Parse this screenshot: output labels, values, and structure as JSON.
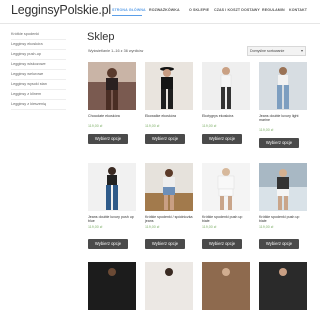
{
  "site": {
    "logo": "LegginsyPolskie.pl"
  },
  "nav": {
    "items": [
      {
        "label": "STRONA GŁÓWNA",
        "active": true
      },
      {
        "label": "ROZWAŻKÓWKA",
        "active": false
      },
      {
        "label": "O SKLEPIE",
        "active": false
      },
      {
        "label": "CZAS I KOSZT DOSTAWY",
        "active": false
      },
      {
        "label": "REGULAMIN",
        "active": false
      },
      {
        "label": "KONTAKT",
        "active": false
      }
    ]
  },
  "sidebar": {
    "items": [
      {
        "label": "Krótkie spodenki"
      },
      {
        "label": "Legginsy ekoskóra"
      },
      {
        "label": "Legginsy push-up"
      },
      {
        "label": "Legginsy wiskozowe"
      },
      {
        "label": "Legginsy welurowe"
      },
      {
        "label": "Legginsy wysoki stan"
      },
      {
        "label": "Legginsy z klinem"
      },
      {
        "label": "Legginsy z kieszenią"
      }
    ]
  },
  "main": {
    "title": "Sklep",
    "result_count": "Wyświetlanie 1–16 z 36 wyników",
    "sort": {
      "selected": "Domyślne sortowanie"
    }
  },
  "products": [
    {
      "name": "Chocolate ekoskóra",
      "price": "119,00 zł",
      "button": "Wybierz opcje"
    },
    {
      "name": "Ekowalke ekoskóra",
      "price": "119,00 zł",
      "button": "Wybierz opcje"
    },
    {
      "name": "Ekotygrys ekoskóra",
      "price": "119,00 zł",
      "button": "Wybierz opcje"
    },
    {
      "name": "Jeans double luxury light marine",
      "price": "119,00 zł",
      "button": "Wybierz opcje"
    },
    {
      "name": "Jeans double luxury push up blue",
      "price": "119,00 zł",
      "button": "Wybierz opcje"
    },
    {
      "name": "Krótkie spodenki / spódniczka jeans",
      "price": "119,00 zł",
      "button": "Wybierz opcje"
    },
    {
      "name": "Krótkie spodenki push up białe",
      "price": "119,00 zł",
      "button": "Wybierz opcje"
    },
    {
      "name": "Krótkie spodenki push up białe",
      "price": "119,00 zł",
      "button": "Wybierz opcje"
    }
  ],
  "colors": {
    "accent": "#5a9ee8",
    "price": "#7fb069",
    "button": "#4a4a4a"
  }
}
